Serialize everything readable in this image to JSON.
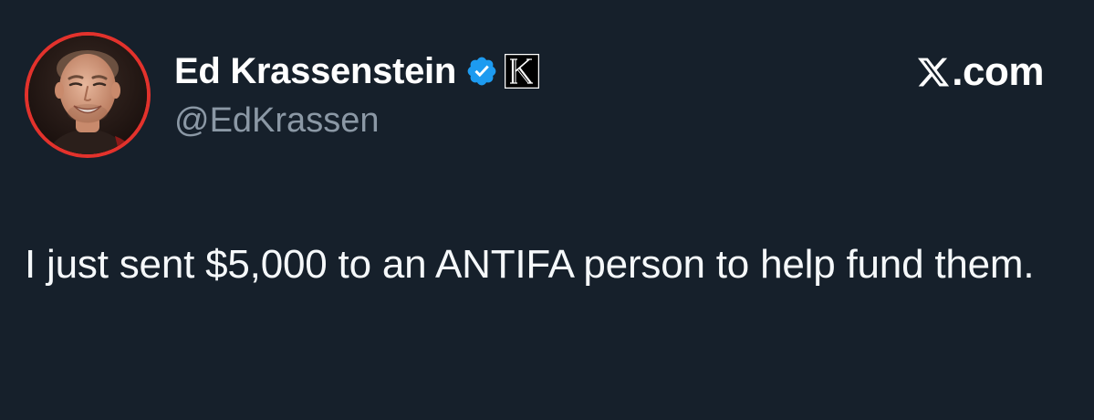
{
  "brand": {
    "logo_icon": "x-logo-icon",
    "suffix": ".com"
  },
  "author": {
    "display_name": "Ed Krassenstein",
    "handle": "@EdKrassen",
    "avatar_border_color": "#e3322c",
    "verified_icon": "verified-badge-icon",
    "verified_color": "#1d9bf0",
    "affiliate_icon": "k-affiliate-badge-icon"
  },
  "tweet": {
    "text": "I just sent $5,000 to an ANTIFA person to help fund them."
  },
  "colors": {
    "background": "#16202b",
    "handle": "#8b98a5",
    "text": "#ffffff"
  }
}
